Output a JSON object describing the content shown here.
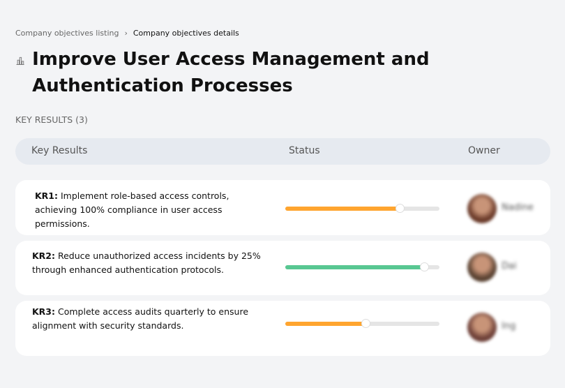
{
  "breadcrumb": {
    "parent": "Company objectives listing",
    "separator": "›",
    "current": "Company objectives details"
  },
  "title": "Improve User Access Management and Authentication Processes",
  "title_icon": "building-icon",
  "key_results_label": "KEY RESULTS (3)",
  "table": {
    "headers": [
      "Key Results",
      "Status",
      "Owner"
    ]
  },
  "rows": [
    {
      "id": "KR1:",
      "text": " Implement role-based access controls, achieving 100% compliance in user access permissions.",
      "progress": 74,
      "color": "#ffa52f",
      "owner": "Nadine",
      "avatar_color": "#6b3b2a"
    },
    {
      "id": "KR2:",
      "text": " Reduce unauthorized access incidents by 25% through enhanced authentication protocols.",
      "progress": 90,
      "color": "#58c792",
      "owner": "Dai",
      "avatar_color": "#5a4232"
    },
    {
      "id": "KR3:",
      "text": " Complete access audits quarterly to ensure alignment with security standards.",
      "progress": 52,
      "color": "#ffa52f",
      "owner": "Ing",
      "avatar_color": "#6e4038"
    }
  ]
}
